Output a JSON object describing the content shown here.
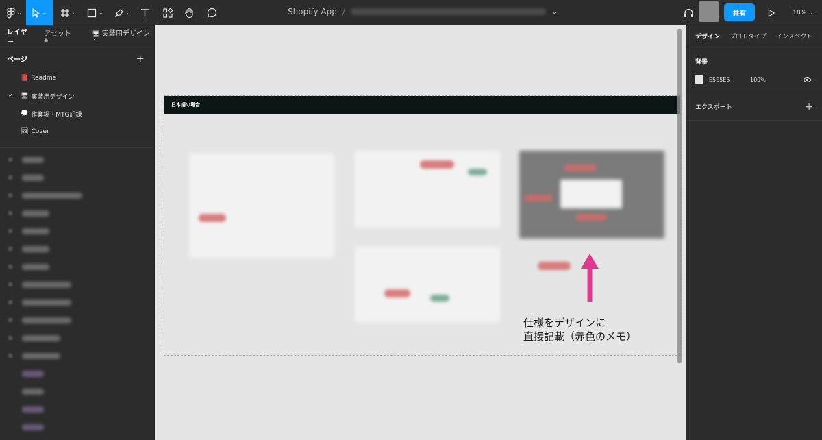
{
  "toolbar": {
    "file_title": "Shopify App",
    "separator": "/",
    "share_label": "共有",
    "zoom": "18%"
  },
  "left_panel": {
    "tab_layers": "レイヤー",
    "tab_assets": "アセット",
    "current_page": "実装用デザイン",
    "pages_header": "ページ",
    "add_symbol": "+",
    "pages": [
      {
        "icon": "📕",
        "label": "Readme",
        "checked": false
      },
      {
        "icon": "🖥",
        "label": "実装用デザイン",
        "checked": true
      },
      {
        "icon": "💭",
        "label": "作業場・MTG記録",
        "checked": false
      },
      {
        "icon": "🖼",
        "label": "Cover",
        "checked": false
      }
    ]
  },
  "canvas": {
    "background": "#E5E5E5",
    "frame_title": "日本語の場合",
    "annotation_line1": "仕様をデザインに",
    "annotation_line2": "直接記載（赤色のメモ）",
    "arrow_color": "#E0388E"
  },
  "right_panel": {
    "tab_design": "デザイン",
    "tab_prototype": "プロトタイプ",
    "tab_inspect": "インスペクト",
    "background_label": "背景",
    "bg_hex": "E5E5E5",
    "bg_opacity": "100%",
    "export_label": "エクスポート",
    "export_add": "+"
  }
}
